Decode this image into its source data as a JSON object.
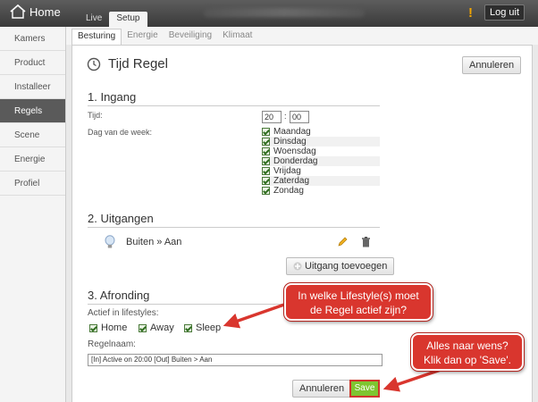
{
  "header": {
    "home_label": "Home",
    "tabs": [
      {
        "label": "Live",
        "active": false
      },
      {
        "label": "Setup",
        "active": true
      }
    ],
    "warning_icon": "!",
    "logout_label": "Log uit"
  },
  "sidebar": {
    "items": [
      {
        "label": "Kamers",
        "active": false
      },
      {
        "label": "Product",
        "active": false
      },
      {
        "label": "Installeer",
        "active": false
      },
      {
        "label": "Regels",
        "active": true
      },
      {
        "label": "Scene",
        "active": false
      },
      {
        "label": "Energie",
        "active": false
      },
      {
        "label": "Profiel",
        "active": false
      }
    ]
  },
  "subtabs": [
    {
      "label": "Besturing",
      "active": true
    },
    {
      "label": "Energie",
      "active": false
    },
    {
      "label": "Beveiliging",
      "active": false
    },
    {
      "label": "Klimaat",
      "active": false
    }
  ],
  "page": {
    "title": "Tijd Regel",
    "cancel_top": "Annuleren"
  },
  "ingang": {
    "title": "1. Ingang",
    "time_label": "Tijd:",
    "hour": "20",
    "separator": ":",
    "minute": "00",
    "days_label": "Dag van de week:",
    "days": [
      "Maandag",
      "Dinsdag",
      "Woensdag",
      "Donderdag",
      "Vrijdag",
      "Zaterdag",
      "Zondag"
    ]
  },
  "uitgangen": {
    "title": "2. Uitgangen",
    "output_text": "Buiten » Aan",
    "add_label": "Uitgang toevoegen"
  },
  "afronding": {
    "title": "3. Afronding",
    "lifestyles_label": "Actief in lifestyles:",
    "lifestyles": [
      "Home",
      "Away",
      "Sleep"
    ],
    "name_label": "Regelnaam:",
    "name_value": "[In] Active on 20:00  [Out] Buiten > Aan",
    "cancel_label": "Annuleren",
    "save_label": "Save"
  },
  "callouts": {
    "lifestyle_line1": "In welke Lifestyle(s) moet",
    "lifestyle_line2": "de Regel actief zijn?",
    "save_line1": "Alles naar wens?",
    "save_line2": "Klik dan op 'Save'."
  },
  "colors": {
    "accent_red": "#d9362e",
    "save_green": "#7ec530",
    "sidebar_active": "#5a5a5a"
  }
}
